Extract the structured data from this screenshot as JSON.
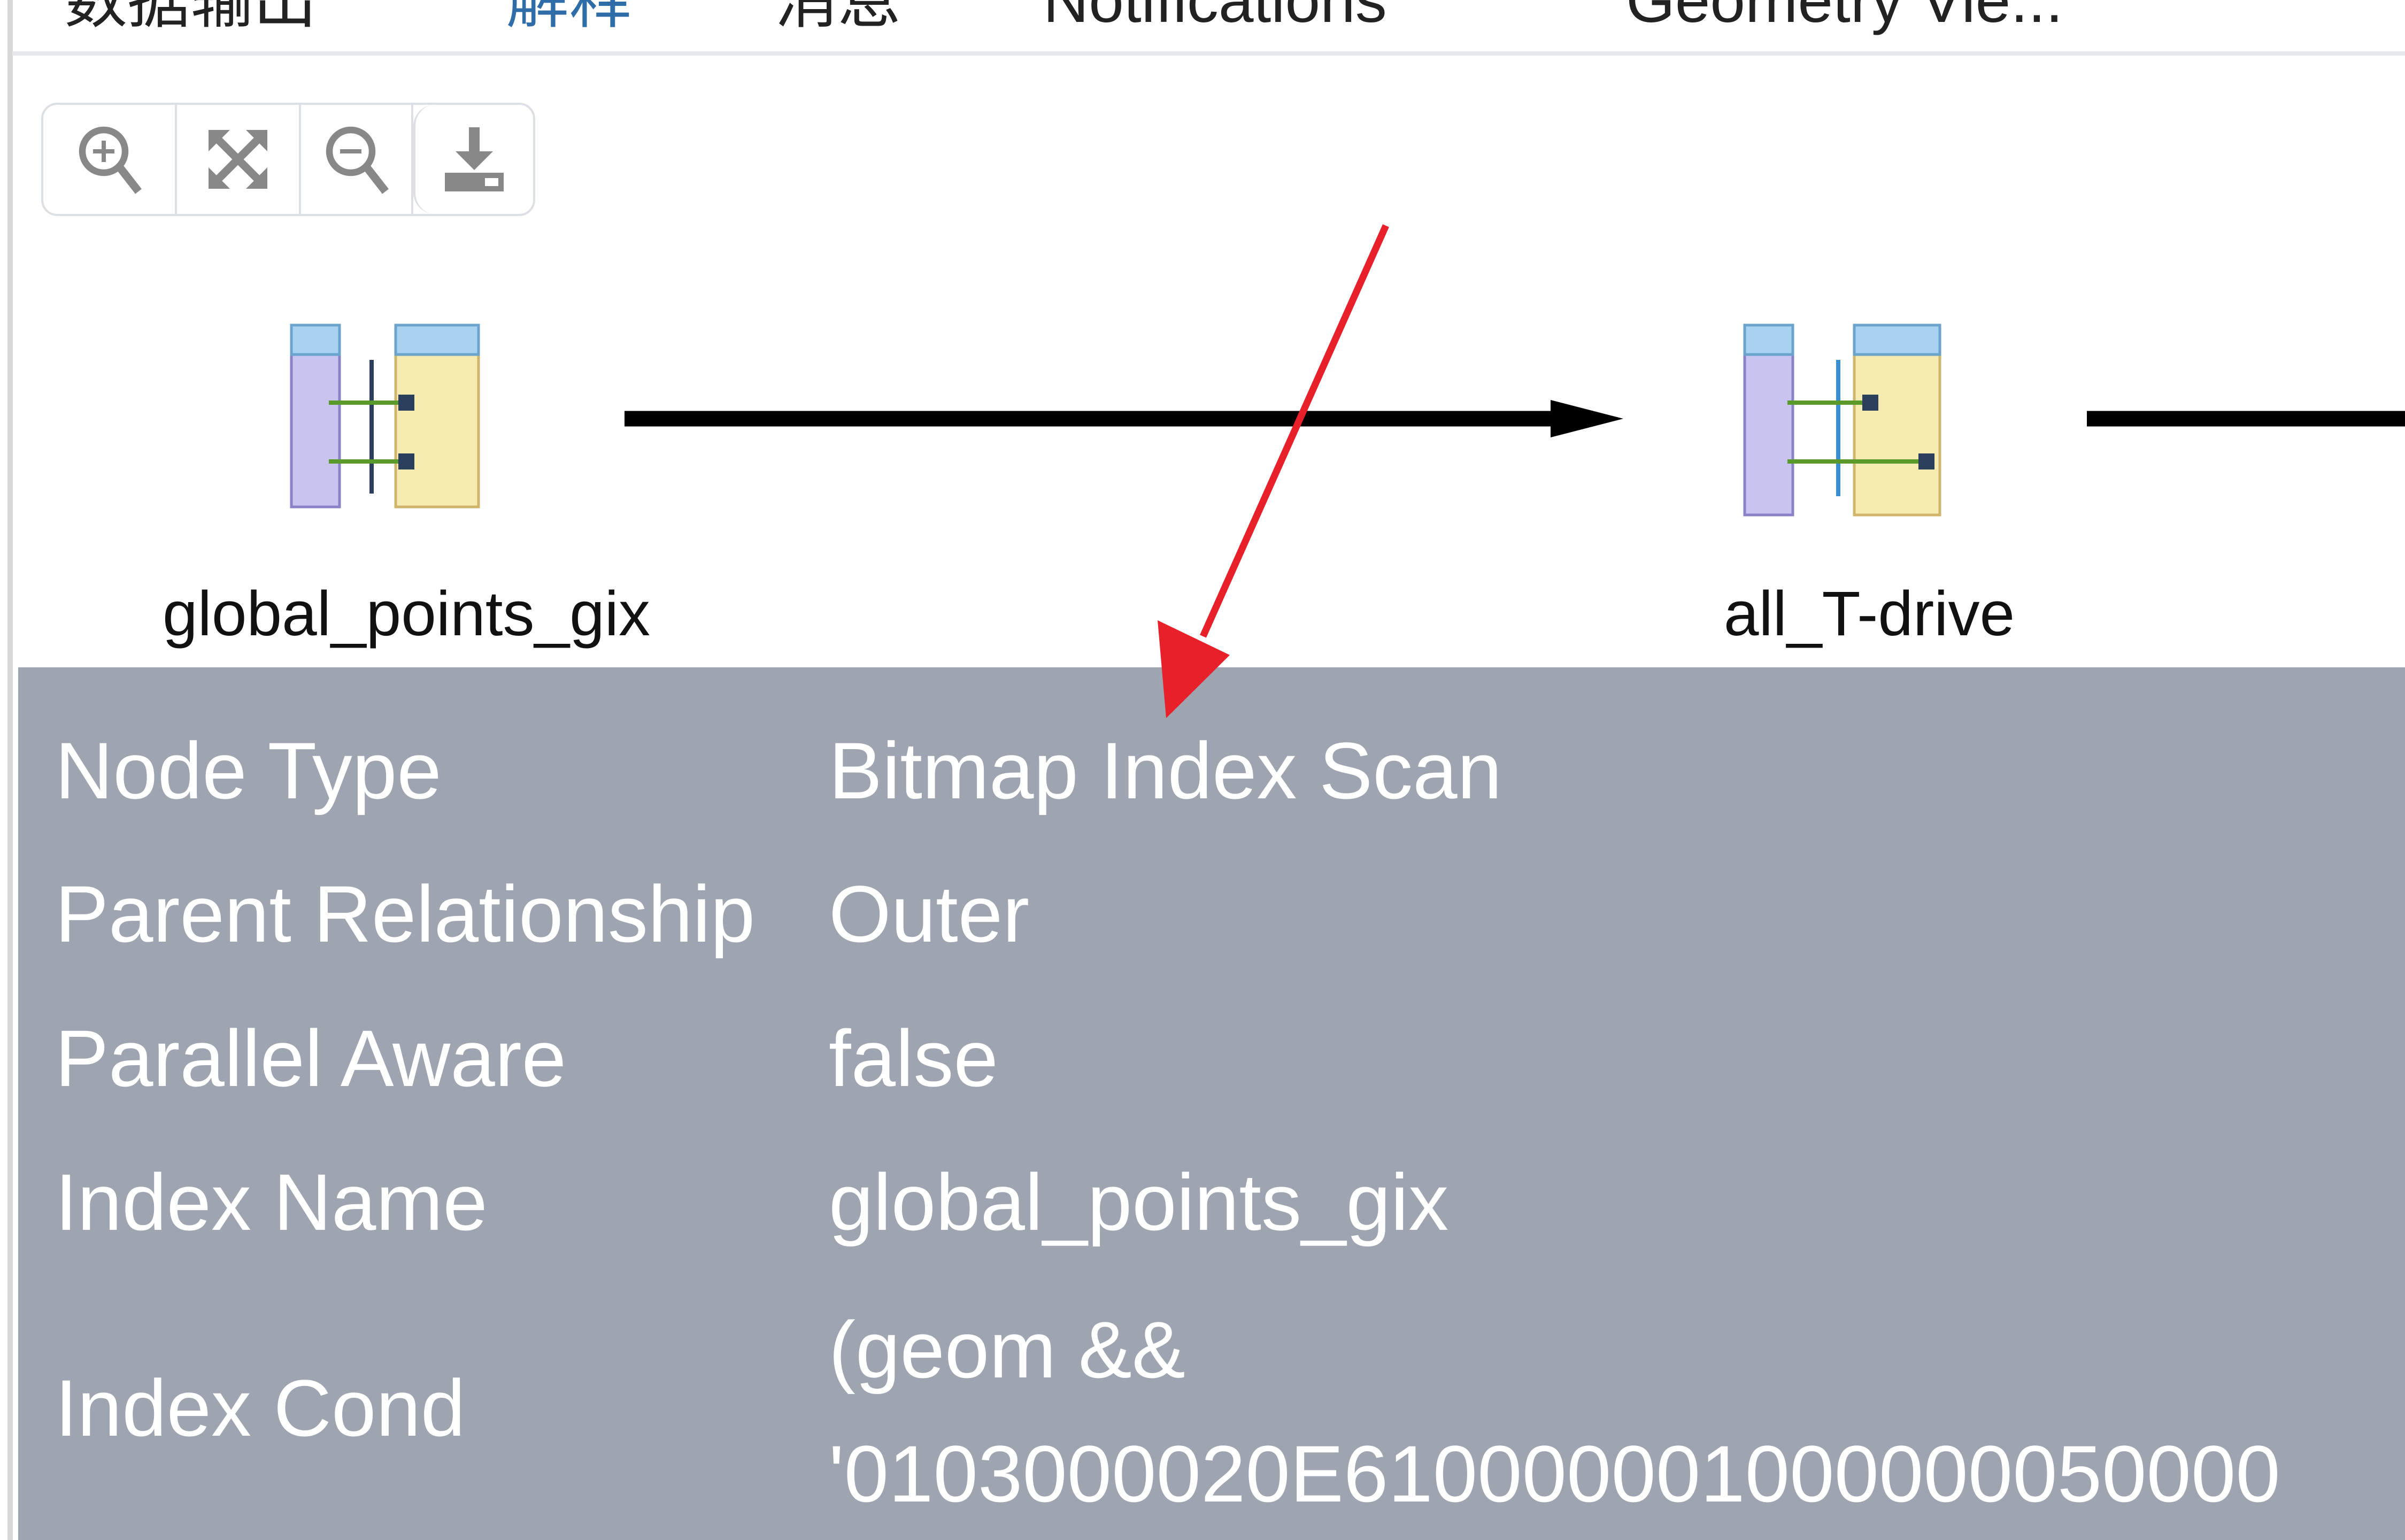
{
  "tabs": [
    {
      "label": "数据输出",
      "active": false
    },
    {
      "label": "解释",
      "active": true
    },
    {
      "label": "消息",
      "active": false
    },
    {
      "label": "Notifications",
      "active": false
    },
    {
      "label": "Geometry Vie...",
      "active": false
    }
  ],
  "toolbar": {
    "buttons": [
      "zoom-in-icon",
      "zoom-to-fit-icon",
      "zoom-out-icon",
      "download-icon"
    ]
  },
  "nodes": [
    {
      "label": "global_points_gix",
      "icon": "bitmap-index-scan-icon"
    },
    {
      "label": "all_T-drive",
      "icon": "bitmap-index-scan-icon"
    }
  ],
  "details": {
    "rows": [
      {
        "label": "Node Type",
        "value": "Bitmap Index Scan"
      },
      {
        "label": "Parent Relationship",
        "value": "Outer"
      },
      {
        "label": "Parallel Aware",
        "value": "false"
      },
      {
        "label": "Index Name",
        "value": "global_points_gix"
      },
      {
        "label": "Index Cond",
        "value_line1": "(geom &&",
        "value_line2": "'0103000020E610000001000000050000"
      }
    ]
  },
  "colors": {
    "active_tab": "#2f6da8",
    "panel_bg": "#9ea5b0",
    "annotation_arrow": "#e8202a"
  }
}
